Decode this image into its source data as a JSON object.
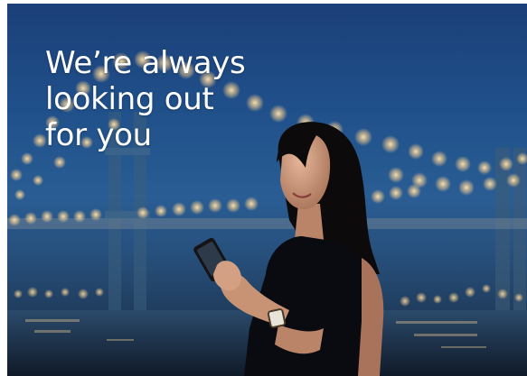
{
  "hero": {
    "headline_lines": [
      "We’re always",
      "looking out",
      "for you"
    ]
  },
  "scene": {
    "subject": "woman looking at smartphone at night",
    "background": "illuminated suspension bridge with bokeh lights over water",
    "colors": {
      "sky_top": "#1b3f78",
      "sky_mid": "#2a5d94",
      "water": "#17263a",
      "bokeh": "#ffe6b3",
      "hair": "#0c0a0a",
      "skin": "#d8a587",
      "top": "#0a0b10"
    }
  }
}
